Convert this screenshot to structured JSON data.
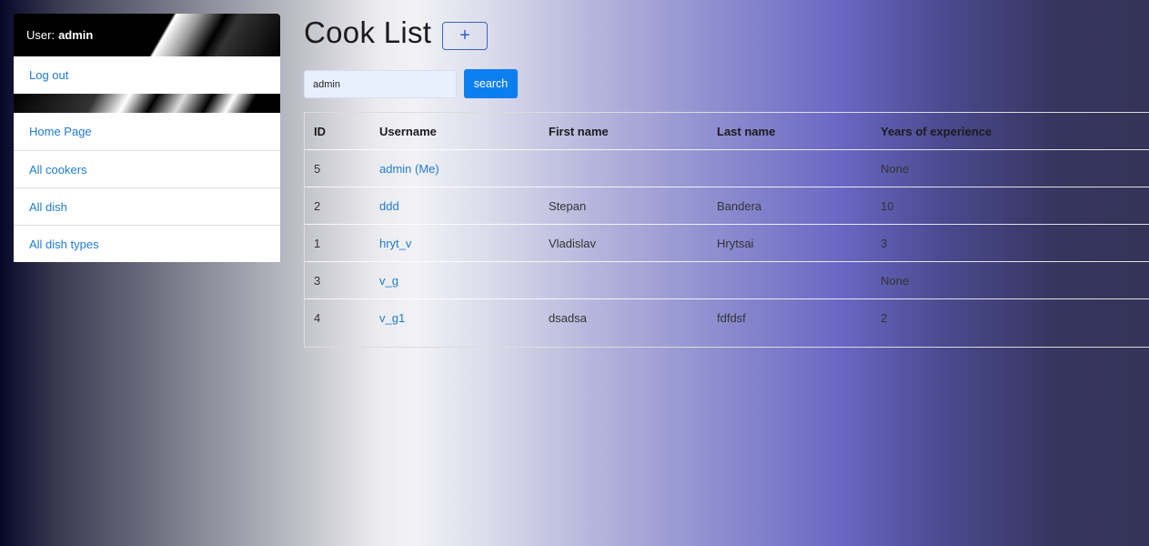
{
  "sidebar": {
    "user_prefix": "User:",
    "username": "admin",
    "logout_label": "Log out",
    "items": [
      {
        "label": "Home Page"
      },
      {
        "label": "All cookers"
      },
      {
        "label": "All dish"
      },
      {
        "label": "All dish types"
      }
    ]
  },
  "main": {
    "title": "Cook List",
    "add_label": "+",
    "search": {
      "value": "admin",
      "button_label": "search"
    },
    "table": {
      "headers": [
        "ID",
        "Username",
        "First name",
        "Last name",
        "Years of experience"
      ],
      "rows": [
        {
          "id": "5",
          "username": "admin (Me)",
          "first_name": "",
          "last_name": "",
          "years": "None"
        },
        {
          "id": "2",
          "username": "ddd",
          "first_name": "Stepan",
          "last_name": "Bandera",
          "years": "10"
        },
        {
          "id": "1",
          "username": "hryt_v",
          "first_name": "Vladislav",
          "last_name": "Hrytsai",
          "years": "3"
        },
        {
          "id": "3",
          "username": "v_g",
          "first_name": "",
          "last_name": "",
          "years": "None"
        },
        {
          "id": "4",
          "username": "v_g1",
          "first_name": "dsadsa",
          "last_name": "fdfdsf",
          "years": "2"
        }
      ]
    }
  },
  "colors": {
    "link": "#1e7bd1",
    "primary_button": "#0d7ef0",
    "add_button_border": "#3366cc"
  }
}
